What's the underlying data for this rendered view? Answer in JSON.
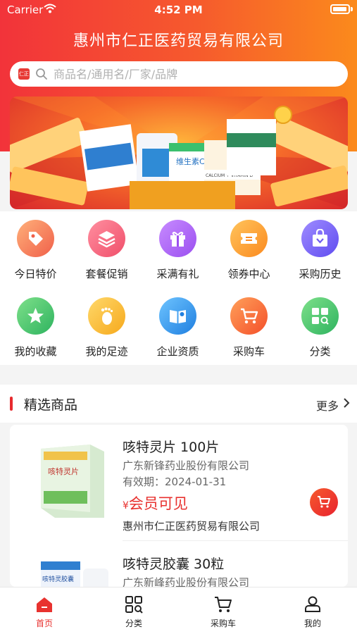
{
  "status_bar": {
    "carrier": "Carrier",
    "time": "4:52 PM"
  },
  "header": {
    "title": "惠州市仁正医药贸易有限公司"
  },
  "search": {
    "placeholder": "商品名/通用名/厂家/品牌",
    "logo_text": "仁正"
  },
  "banner": {
    "product_labels": [
      "维生素C·E",
      "CALCIUM + VITAMIN D"
    ]
  },
  "menu": {
    "items": [
      {
        "label": "今日特价",
        "icon": "tag-icon",
        "color": "#f0604a"
      },
      {
        "label": "套餐促销",
        "icon": "layers-icon",
        "color": "#f04f6a"
      },
      {
        "label": "采满有礼",
        "icon": "gift-icon",
        "color": "#9b4ff0"
      },
      {
        "label": "领券中心",
        "icon": "coupon-icon",
        "color": "#fb9a1f"
      },
      {
        "label": "采购历史",
        "icon": "shopping-bag-icon",
        "color": "#6f5cf0"
      },
      {
        "label": "我的收藏",
        "icon": "star-icon",
        "color": "#3ac06e"
      },
      {
        "label": "我的足迹",
        "icon": "footprint-icon",
        "color": "#fbb428"
      },
      {
        "label": "企业资质",
        "icon": "certificate-icon",
        "color": "#2f8ff0"
      },
      {
        "label": "采购车",
        "icon": "cart-icon",
        "color": "#f7622c"
      },
      {
        "label": "分类",
        "icon": "category-grid-icon",
        "color": "#3cc067"
      }
    ]
  },
  "featured": {
    "title": "精选商品",
    "more_label": "更多",
    "products": [
      {
        "name": "咳特灵片 100片",
        "manufacturer": "广东新锋药业股份有限公司",
        "expiry": "有效期：2024-01-31",
        "price_symbol": "¥",
        "price_text": "会员可见",
        "seller": "惠州市仁正医药贸易有限公司",
        "box_label": "咳特灵片"
      },
      {
        "name": "咳特灵胶囊 30粒",
        "manufacturer": "广东新峰药业股份有限公司",
        "box_label": "咳特灵胶囊"
      }
    ]
  },
  "tabbar": {
    "tabs": [
      {
        "label": "首页",
        "icon": "home-icon",
        "active": true
      },
      {
        "label": "分类",
        "icon": "scan-category-icon",
        "active": false
      },
      {
        "label": "采购车",
        "icon": "cart-icon",
        "active": false
      },
      {
        "label": "我的",
        "icon": "profile-icon",
        "active": false
      }
    ]
  },
  "colors": {
    "brand_red": "#e8322f",
    "header_start": "#f2333a",
    "header_end": "#fb8a1c"
  }
}
